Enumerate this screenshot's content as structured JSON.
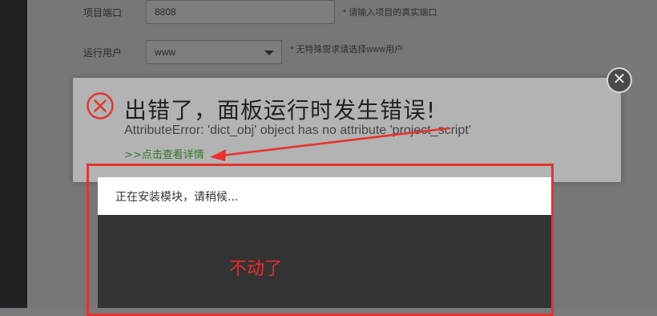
{
  "form": {
    "port_label": "项目端口",
    "port_value": "8808",
    "port_hint": "* 请输入项目的真实端口",
    "user_label": "运行用户",
    "user_value": "www",
    "user_hint": "* 无特殊需求请选择www用户"
  },
  "error_dialog": {
    "title": "出错了，面板运行时发生错误!",
    "message": "AttributeError: 'dict_obj' object has no attribute 'project_script'",
    "details_link": ">>点击查看详情",
    "close_icon": "close-icon",
    "error_icon": "error-circle-x-icon"
  },
  "install_dialog": {
    "status_text": "正在安装模块，请稍候..."
  },
  "annotation": {
    "note": "不动了",
    "highlight_color": "#e8322b"
  }
}
